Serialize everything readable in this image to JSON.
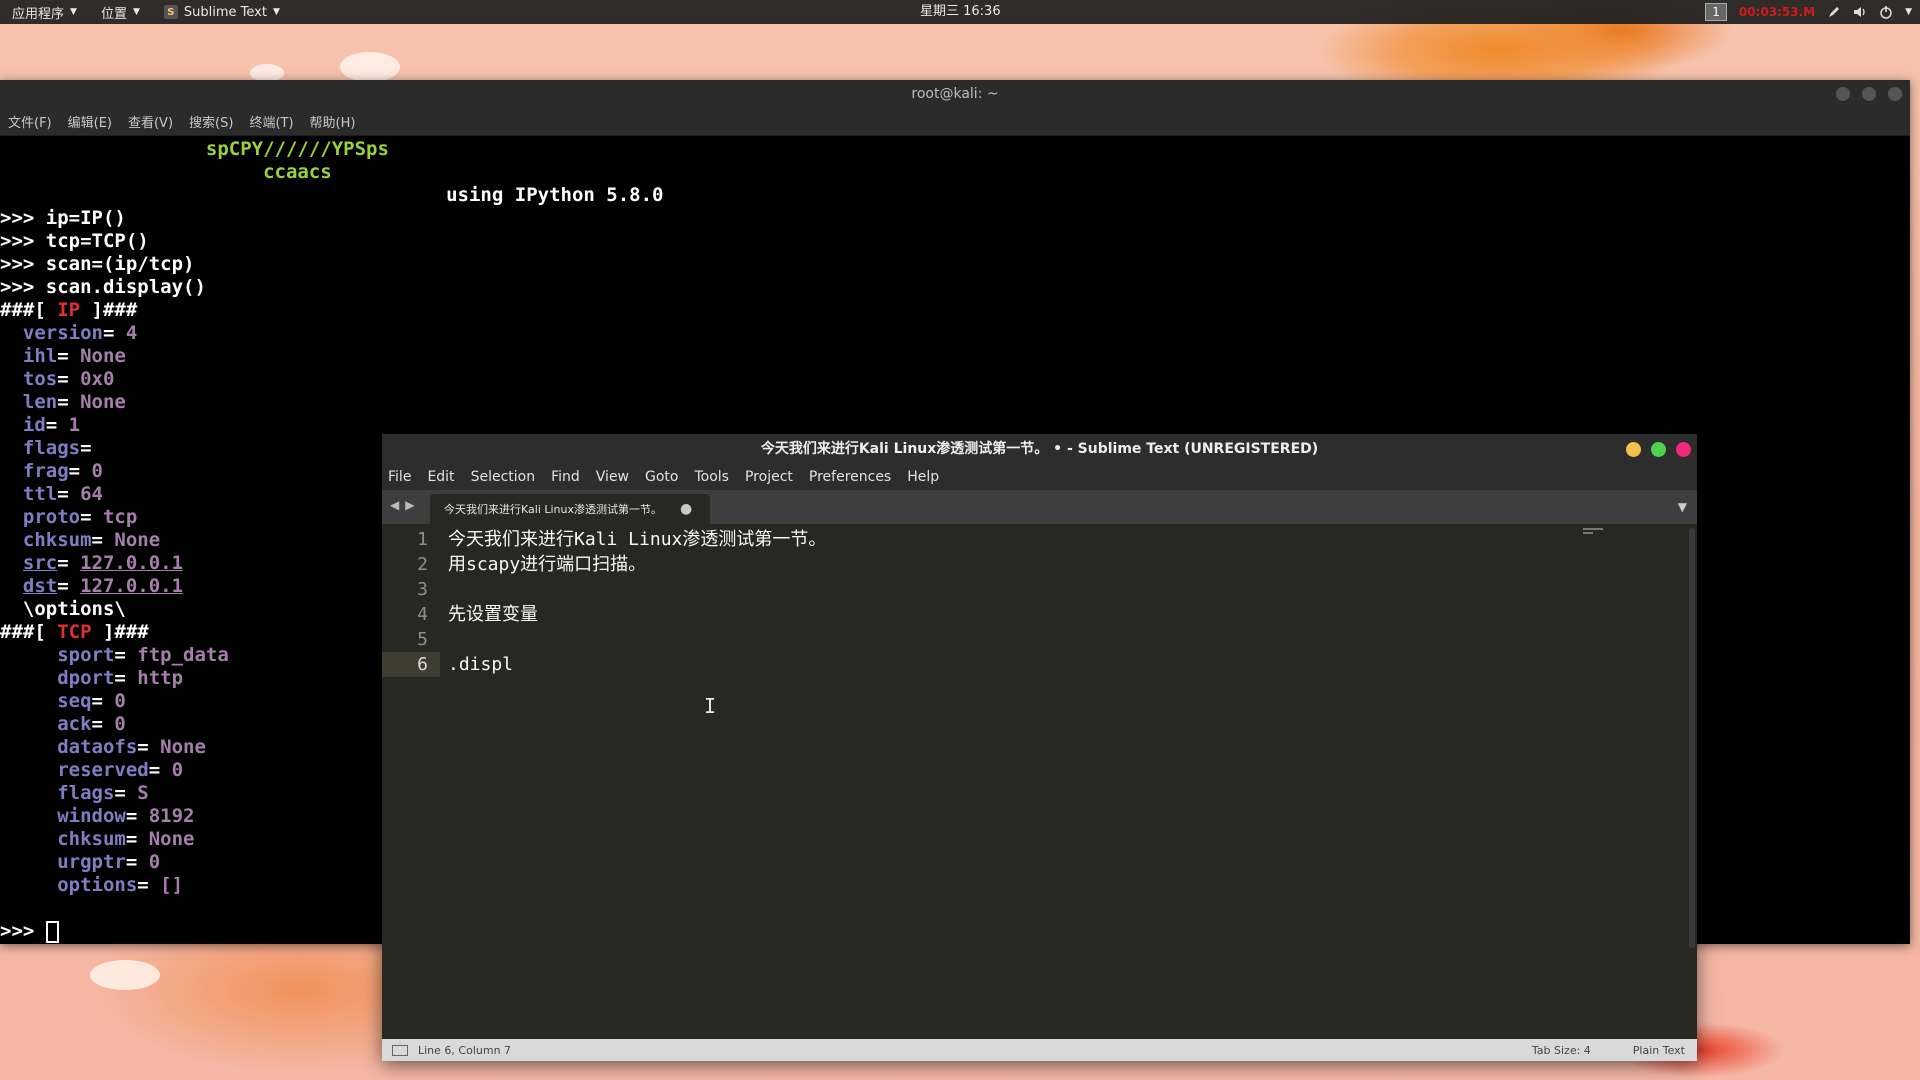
{
  "topbar": {
    "applications": "应用程序",
    "places": "位置",
    "app_name": "Sublime Text",
    "app_logo": "S",
    "clock": "星期三 16:36",
    "workspace": "1",
    "timer": "00:03:53.M",
    "icons": [
      "pen-icon",
      "volume-icon",
      "power-icon",
      "caret-down-icon"
    ]
  },
  "terminal": {
    "title": "root@kali: ~",
    "menu": [
      "文件(F)",
      "编辑(E)",
      "查看(V)",
      "搜索(S)",
      "终端(T)",
      "帮助(H)"
    ],
    "lines": {
      "l0_green": "                  spCPY//////YPSps",
      "l1_green": "                       ccaacs",
      "l2": "                                       using IPython 5.8.0",
      "l3": ">>> ip=IP()",
      "l4": ">>> tcp=TCP()",
      "l5": ">>> scan=(ip/tcp)",
      "l6": ">>> scan.display()",
      "ip_header_pre": "###[ ",
      "ip_header_name": "IP",
      "ip_header_post": " ]###",
      "tcp_header_name": "TCP",
      "prompt": ">>> "
    },
    "ip_fields": [
      {
        "name": "version",
        "value": "4"
      },
      {
        "name": "ihl",
        "value": "None"
      },
      {
        "name": "tos",
        "value": "0x0"
      },
      {
        "name": "len",
        "value": "None"
      },
      {
        "name": "id",
        "value": "1"
      },
      {
        "name": "flags",
        "value": ""
      },
      {
        "name": "frag",
        "value": "0"
      },
      {
        "name": "ttl",
        "value": "64"
      },
      {
        "name": "proto",
        "value": "tcp"
      },
      {
        "name": "chksum",
        "value": "None"
      },
      {
        "name": "src",
        "value": "127.0.0.1"
      },
      {
        "name": "dst",
        "value": "127.0.0.1"
      }
    ],
    "options_line": "  \\options\\",
    "tcp_fields": [
      {
        "name": "sport",
        "value": "ftp_data"
      },
      {
        "name": "dport",
        "value": "http"
      },
      {
        "name": "seq",
        "value": "0"
      },
      {
        "name": "ack",
        "value": "0"
      },
      {
        "name": "dataofs",
        "value": "None"
      },
      {
        "name": "reserved",
        "value": "0"
      },
      {
        "name": "flags",
        "value": "S"
      },
      {
        "name": "window",
        "value": "8192"
      },
      {
        "name": "chksum",
        "value": "None"
      },
      {
        "name": "urgptr",
        "value": "0"
      },
      {
        "name": "options",
        "value": "[]"
      }
    ]
  },
  "sublime": {
    "title": "今天我们来进行Kali Linux渗透测试第一节。 • - Sublime Text (UNREGISTERED)",
    "menu": [
      "File",
      "Edit",
      "Selection",
      "Find",
      "View",
      "Goto",
      "Tools",
      "Project",
      "Preferences",
      "Help"
    ],
    "tab_label": "今天我们来进行Kali Linux渗透测试第一节。",
    "tab_dirty": "●",
    "lines": [
      {
        "n": "1",
        "text": "今天我们来进行Kali Linux渗透测试第一节。"
      },
      {
        "n": "2",
        "text": "用scapy进行端口扫描。"
      },
      {
        "n": "3",
        "text": ""
      },
      {
        "n": "4",
        "text": "先设置变量"
      },
      {
        "n": "5",
        "text": ""
      },
      {
        "n": "6",
        "text": ".displ"
      }
    ],
    "status_position": "Line 6, Column 7",
    "tab_size": "Tab Size: 4",
    "syntax": "Plain Text"
  },
  "colors": {
    "terminal_bg": "#000000",
    "green_banner": "#9bd23b",
    "red_layer": "#e03030",
    "field": "#7f7ec2",
    "value": "#a47faa",
    "sublime_bg": "#272822"
  }
}
